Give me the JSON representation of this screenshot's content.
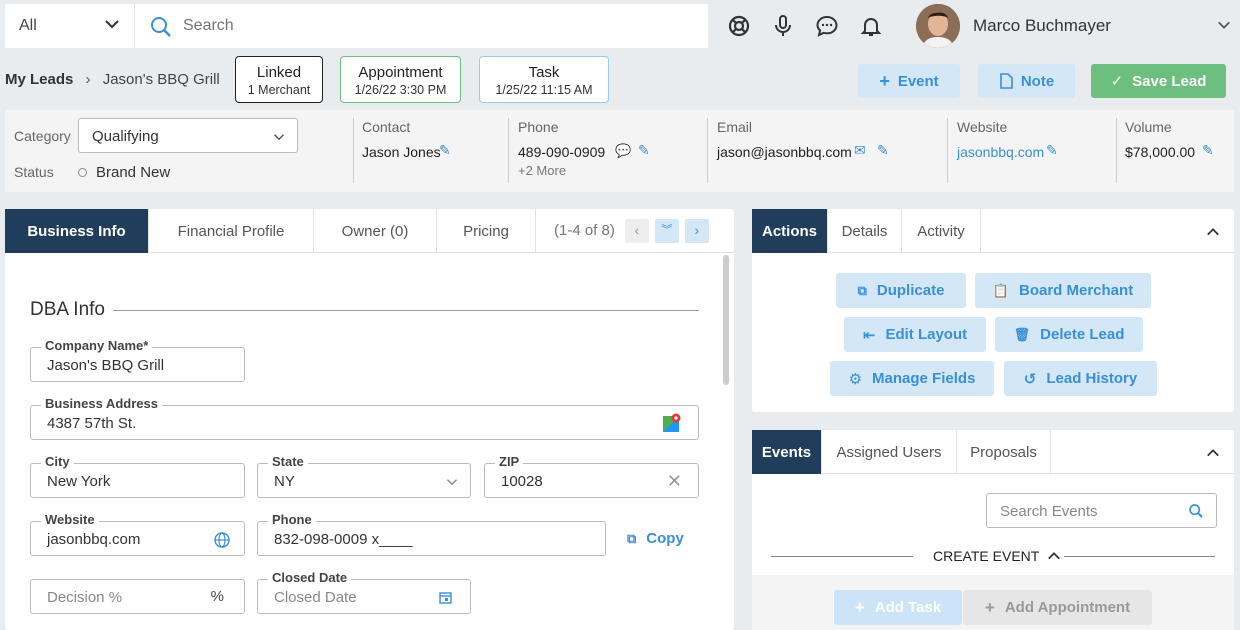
{
  "search": {
    "scope": "All",
    "placeholder": "Search"
  },
  "user": {
    "name": "Marco Buchmayer"
  },
  "breadcrumb": {
    "root": "My Leads",
    "current": "Jason's BBQ Grill"
  },
  "chips": [
    {
      "title": "Linked",
      "sub": "1 Merchant"
    },
    {
      "title": "Appointment",
      "sub": "1/26/22 3:30 PM"
    },
    {
      "title": "Task",
      "sub": "1/25/22 11:15 AM"
    }
  ],
  "actions_top": {
    "event": "Event",
    "note": "Note",
    "save": "Save Lead"
  },
  "summary": {
    "category_label": "Category",
    "category_value": "Qualifying",
    "status_label": "Status",
    "status_value": "Brand New",
    "contact_label": "Contact",
    "contact_value": "Jason Jones",
    "phone_label": "Phone",
    "phone_value": "489-090-0909",
    "phone_more": "+2 More",
    "email_label": "Email",
    "email_value": "jason@jasonbbq.com",
    "website_label": "Website",
    "website_value": "jasonbbq.com",
    "volume_label": "Volume",
    "volume_value": "$78,000.00"
  },
  "left_tabs": [
    "Business Info",
    "Financial Profile",
    "Owner (0)",
    "Pricing"
  ],
  "pager": "(1-4 of 8)",
  "dba": {
    "title": "DBA Info",
    "company_label": "Company Name*",
    "company_value": "Jason's BBQ Grill",
    "address_label": "Business Address",
    "address_value": "4387 57th St.",
    "city_label": "City",
    "city_value": "New York",
    "state_label": "State",
    "state_value": "NY",
    "zip_label": "ZIP",
    "zip_value": "10028",
    "website_label": "Website",
    "website_value": "jasonbbq.com",
    "phone_label": "Phone",
    "phone_value": "832-098-0009 x____",
    "copy": "Copy",
    "decision_placeholder": "Decision %",
    "closed_label": "Closed Date",
    "closed_placeholder": "Closed Date"
  },
  "right_tabs": [
    "Actions",
    "Details",
    "Activity"
  ],
  "action_buttons": {
    "duplicate": "Duplicate",
    "board": "Board Merchant",
    "edit_layout": "Edit Layout",
    "delete": "Delete Lead",
    "manage": "Manage Fields",
    "history": "Lead History"
  },
  "event_tabs": [
    "Events",
    "Assigned Users",
    "Proposals"
  ],
  "events": {
    "search_placeholder": "Search Events",
    "create": "CREATE EVENT",
    "add_task": "Add Task",
    "add_appointment": "Add Appointment"
  },
  "colors": {
    "navy": "#203e5c",
    "accent": "#3a8fd6",
    "green": "#6cbf7e"
  }
}
